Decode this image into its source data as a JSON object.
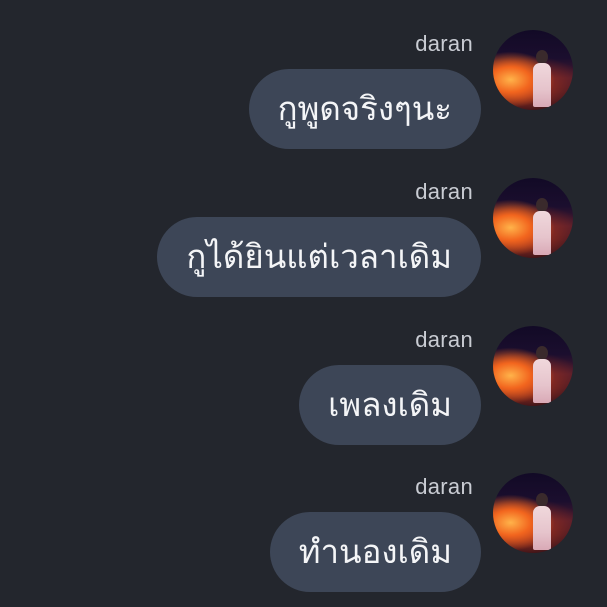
{
  "messages": [
    {
      "sender": "daran",
      "text": "กูพูดจริงๆนะ"
    },
    {
      "sender": "daran",
      "text": "กูได้ยินแต่เวลาเดิม"
    },
    {
      "sender": "daran",
      "text": "เพลงเดิม"
    },
    {
      "sender": "daran",
      "text": "ทำนองเดิม"
    }
  ],
  "colors": {
    "background": "#23262d",
    "bubble": "#3d4657",
    "bubble_text": "#f4f5f7",
    "sender_text": "#c9ccd3"
  }
}
